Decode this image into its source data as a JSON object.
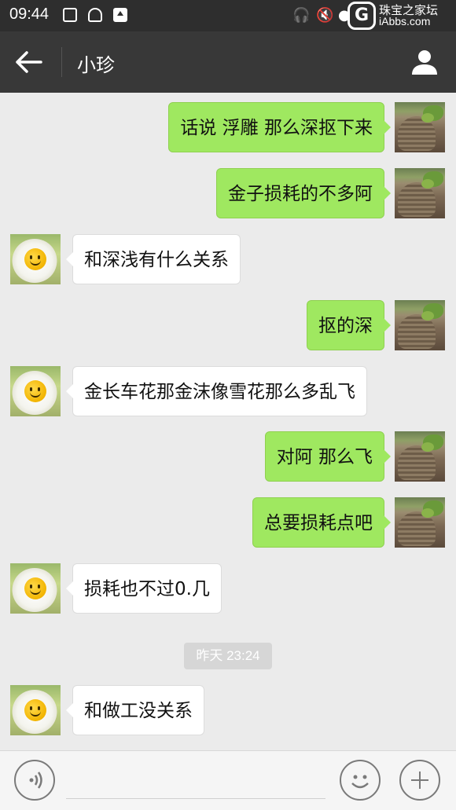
{
  "status_bar": {
    "time": "09:44",
    "left_icons": [
      "image-icon",
      "notification-bell-icon",
      "upload-icon"
    ],
    "right_icons": [
      "headset-icon",
      "mute-icon",
      "camera-icon"
    ],
    "watermark_line1": "珠宝之家坛",
    "watermark_line2": "iAbbs.com"
  },
  "nav": {
    "title": "小珍"
  },
  "messages": [
    {
      "from": "me",
      "text": "话说 浮雕 那么深抠下来"
    },
    {
      "from": "me",
      "text": "金子损耗的不多阿"
    },
    {
      "from": "other",
      "text": "和深浅有什么关系"
    },
    {
      "from": "me",
      "text": "抠的深"
    },
    {
      "from": "other",
      "text": "金长车花那金沫像雪花那么多乱飞"
    },
    {
      "from": "me",
      "text": "对阿 那么飞"
    },
    {
      "from": "me",
      "text": "总要损耗点吧"
    },
    {
      "from": "other",
      "text": "损耗也不过0.几"
    },
    {
      "from": "other",
      "text": "和做工没关系"
    }
  ],
  "timestamp": "昨天 23:24",
  "colors": {
    "nav_bg": "#383838",
    "chat_bg": "#ebebeb",
    "out_bubble": "#9fe860",
    "in_bubble": "#ffffff"
  }
}
